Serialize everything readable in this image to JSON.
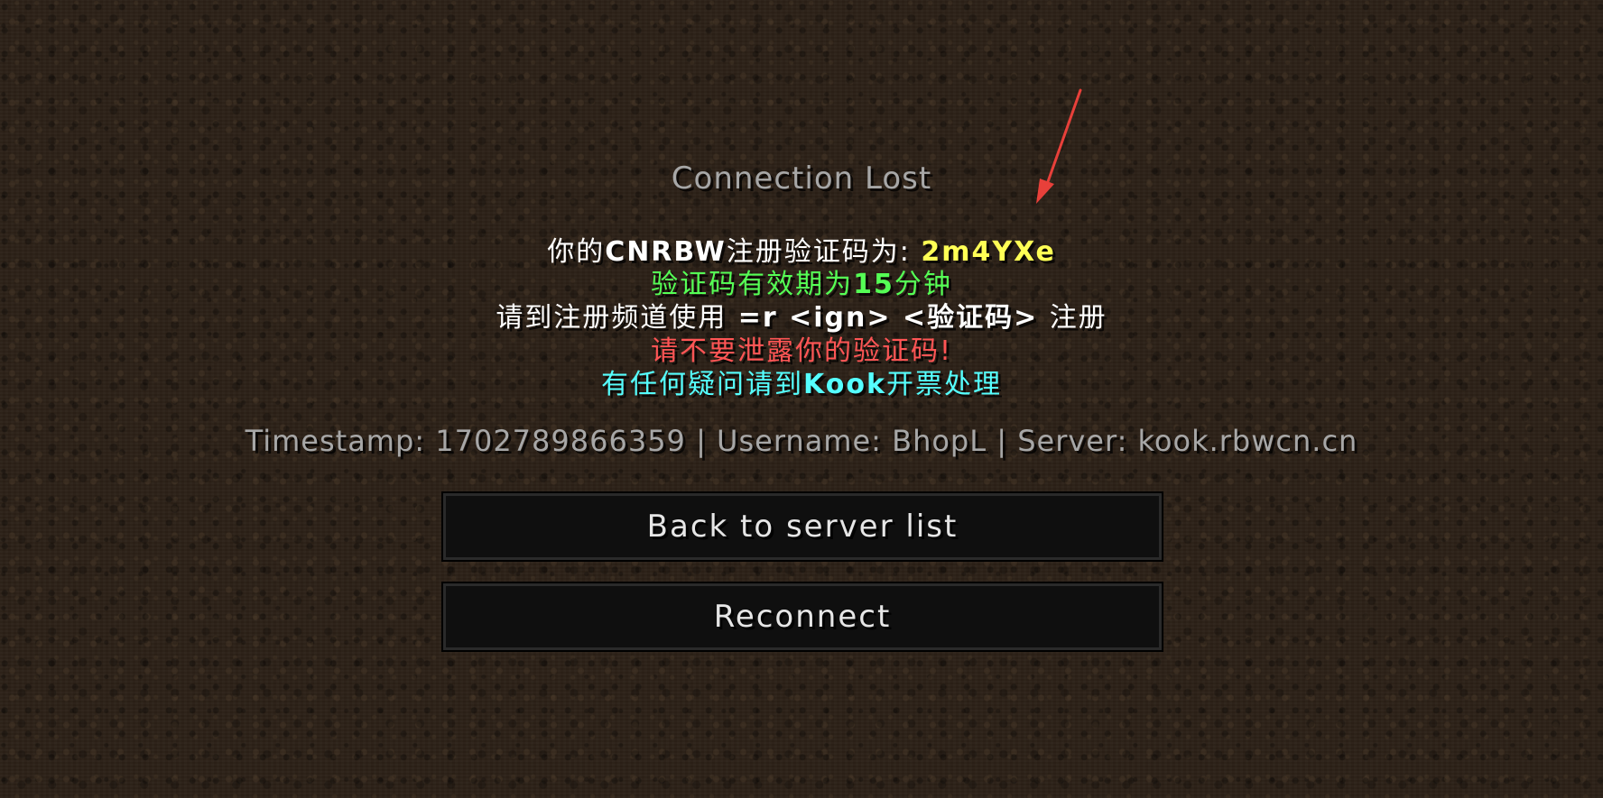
{
  "screen": {
    "title": "Connection Lost"
  },
  "message": {
    "line1_prefix": "你的",
    "line1_brand": "CNRBW",
    "line1_mid": "注册验证码为:",
    "line1_code": "2m4YXe",
    "line2_prefix": "验证码有效期为",
    "line2_number": "15",
    "line2_suffix": "分钟",
    "line3_prefix": "请到注册频道使用",
    "line3_command": " =r <ign> <验证码> ",
    "line3_suffix": "注册",
    "line4": "请不要泄露你的验证码!",
    "line5_prefix": "有任何疑问请到",
    "line5_brand": "Kook",
    "line5_suffix": "开票处理"
  },
  "info": {
    "text": "Timestamp: 1702789866359 | Username: BhopL | Server: kook.rbwcn.cn"
  },
  "buttons": {
    "back": "Back to server list",
    "reconnect": "Reconnect"
  },
  "colors": {
    "title": "#a7a7a7",
    "white": "#ffffff",
    "yellow": "#ffff55",
    "green": "#55ff55",
    "red": "#ff5555",
    "aqua": "#55ffff",
    "annotation_arrow": "#e8403a"
  },
  "annotation": {
    "icon": "red-arrow-icon"
  }
}
